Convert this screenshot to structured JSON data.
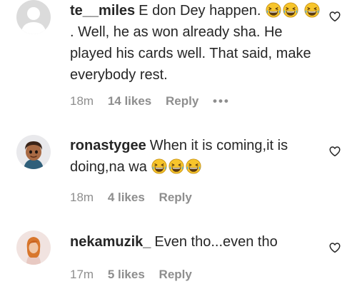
{
  "comments": [
    {
      "username": "te__miles",
      "text_1": "E don Dey happen.",
      "text_2": ". Well, he as won already sha. He played his cards well. That said, make everybody rest.",
      "time": "18m",
      "likes": "14 likes",
      "reply": "Reply",
      "more": "•••",
      "avatar": "default-avatar-icon"
    },
    {
      "username": "ronastygee",
      "text_1": "When it is coming,it is doing,na wa",
      "time": "18m",
      "likes": "4 likes",
      "reply": "Reply",
      "avatar": "cartoon-avatar"
    },
    {
      "username": "nekamuzik_",
      "text_1": "Even tho...even tho",
      "time": "17m",
      "likes": "5 likes",
      "reply": "Reply",
      "avatar": "photo-avatar"
    }
  ],
  "icons": {
    "like": "heart-outline-icon",
    "emoji": "grinning-squinting-face-emoji"
  },
  "colors": {
    "primary_text": "#262626",
    "secondary_text": "#8e8e8e",
    "emoji_face": "#f7c52b"
  }
}
